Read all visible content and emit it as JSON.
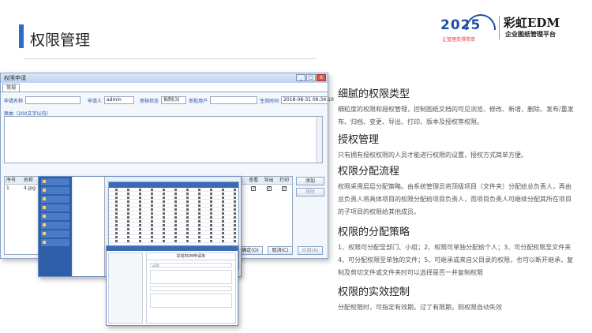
{
  "page_title": "权限管理",
  "logo": {
    "year": "2025",
    "slogan": "让管理变得简单",
    "brand": "彩虹EDM",
    "subtitle": "企业图纸管理平台"
  },
  "dialog": {
    "title": "权限申请",
    "tab": "常规",
    "controls": [
      "_",
      "□",
      "X"
    ],
    "fields": {
      "request_no_label": "申请名称",
      "request_no_value": "",
      "requester_label": "申请人",
      "requester_value": "admin",
      "status_label": "审核状态",
      "status_value": "拟制(3)",
      "reviewer_label": "审批用户",
      "reviewer_value": "",
      "effective_label": "生效时间",
      "effective_value": "2018-08-31 09:34:10"
    },
    "notes_label": "原由（200文字以内）",
    "columns": [
      "序号",
      "名称",
      "可见",
      "浏览",
      "修改",
      "新增",
      "复制",
      "借用",
      "剪切",
      "删除",
      "归档",
      "取消归档",
      "发布",
      "废止",
      "查看",
      "导出",
      "打印"
    ],
    "rows": [
      {
        "idx": "1",
        "name": "4.jpg",
        "perms": [
          true,
          true,
          true,
          true,
          true,
          true,
          true,
          true,
          false,
          false,
          false,
          false,
          true,
          true,
          true
        ]
      }
    ],
    "add_button": "添加",
    "remove_button": "移除",
    "ok_button": "确定(O)",
    "cancel_button": "取消(C)",
    "apply_button": "应用(A)"
  },
  "sections": [
    {
      "heading": "细腻的权限类型",
      "body": "细粒度的权限和授权管理，控制图纸文档的可见浏览、修改、新增、删除、发布/重发布、归档、变更、导出、打印、版本及授权等权限。"
    },
    {
      "heading": "授权管理",
      "body": "只有拥有授权权限的人员才能进行权限的设置，授权方式简单方便。"
    },
    {
      "heading": "权限分配流程",
      "body": "权限采用层层分配策略。由系统管理员将顶级项目（文件夹）分配给总负责人，再由总负责人将具体项目的权限分配给项目负责人，而项目负责人可继续分配其所在项目的子项目的权限给其他成员。"
    },
    {
      "heading": "权限的分配策略",
      "body": "1、权限可分配至部门、小组；2、权限可单独分配给个人；3、可分配权限至文件夹4、可分配权限至单独的文件；5、可继承或来自父目录的权限，也可以断开继承，复制及剪切文件或文件夹时可以选择是否一并复制权限"
    },
    {
      "heading": "权限的实效控制",
      "body": "分配权限时，可指定有效期，过了有限期，则权限自动失效"
    }
  ],
  "overlay2": {
    "header": "彩虹EDM申请单",
    "field1": "公司："
  }
}
